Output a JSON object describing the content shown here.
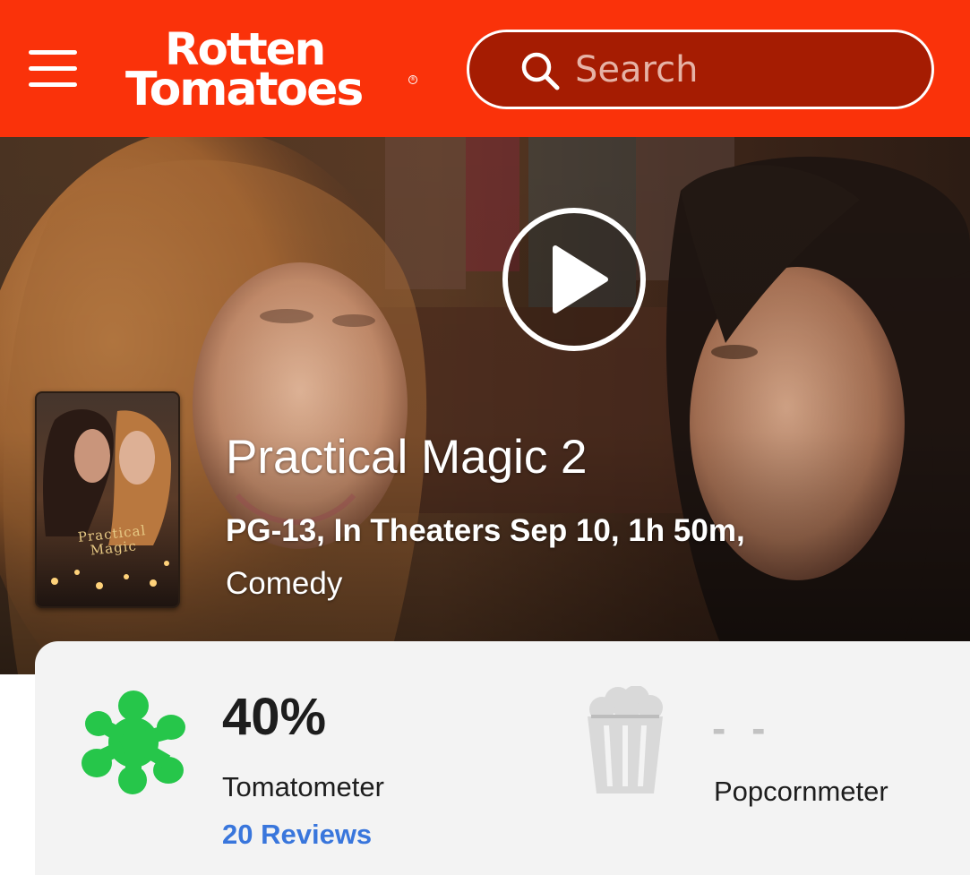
{
  "header": {
    "brand": {
      "line1": "Rotten",
      "line2": "Tomatoes",
      "registered": "®"
    },
    "menu_icon": "hamburger-menu-icon",
    "search": {
      "placeholder": "Search",
      "value": "",
      "icon": "search-icon"
    },
    "colors": {
      "background": "#fa320a",
      "search_fill": "#a51c02"
    }
  },
  "hero": {
    "play_icon": "play-icon",
    "poster_title": "Practical Magic",
    "title": "Practical Magic 2",
    "meta": "PG-13, In Theaters Sep 10, 1h 50m,",
    "genre": "Comedy"
  },
  "scores": {
    "tomatometer": {
      "icon": "rotten-splat-icon",
      "value": "40%",
      "label": "Tomatometer",
      "reviews": "20 Reviews",
      "color": "#26c64a"
    },
    "popcornmeter": {
      "icon": "popcorn-bucket-icon",
      "value": "- -",
      "label": "Popcornmeter"
    },
    "link_color": "#3976dc"
  }
}
